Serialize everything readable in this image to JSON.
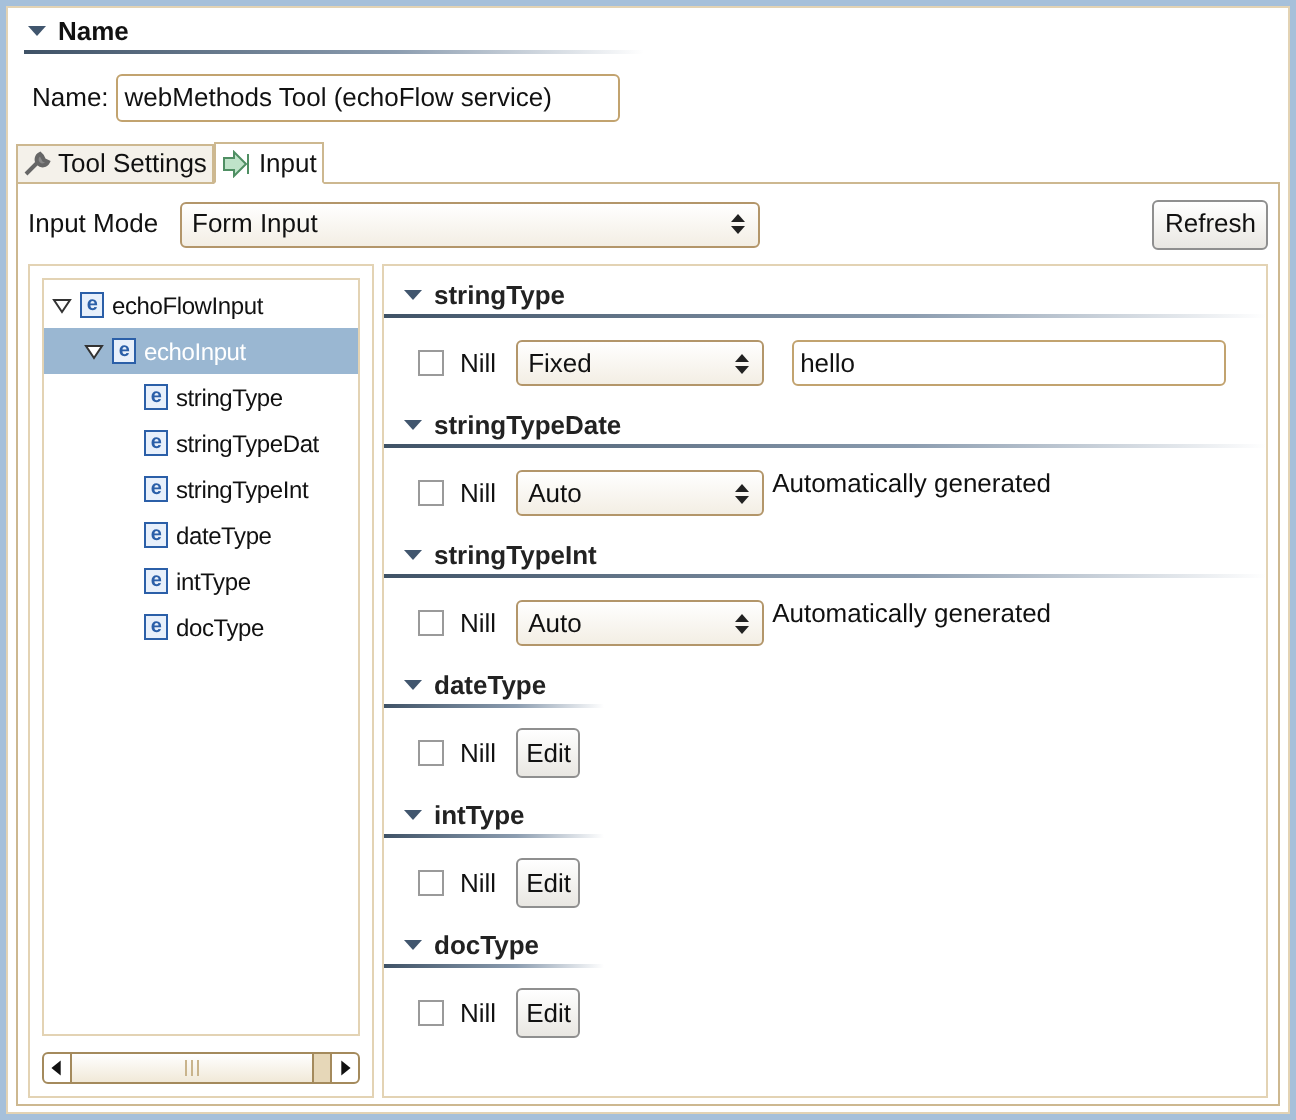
{
  "name_section": {
    "title": "Name",
    "label": "Name:",
    "value": "webMethods Tool (echoFlow service)"
  },
  "tabs": [
    {
      "label": "Tool Settings",
      "kind": "settings",
      "selected": false
    },
    {
      "label": "Input",
      "kind": "input",
      "selected": true
    }
  ],
  "input_mode": {
    "label": "Input Mode",
    "value": "Form Input",
    "refresh": "Refresh"
  },
  "tree": [
    {
      "badge": "e",
      "label": "echoFlowInput",
      "expanded": true,
      "selected": false,
      "children": [
        {
          "badge": "e",
          "label": "echoInput",
          "expanded": true,
          "selected": true,
          "children": [
            {
              "badge": "e",
              "label": "stringType",
              "selected": false
            },
            {
              "badge": "e",
              "label": "stringTypeDat",
              "selected": false
            },
            {
              "badge": "e",
              "label": "stringTypeInt",
              "selected": false
            },
            {
              "badge": "e",
              "label": "dateType",
              "selected": false
            },
            {
              "badge": "e",
              "label": "intType",
              "selected": false
            },
            {
              "badge": "e",
              "label": "docType",
              "selected": false
            }
          ]
        }
      ]
    }
  ],
  "fields": [
    {
      "title": "stringType",
      "kind": "select_text",
      "nill_label": "Nill",
      "checked": false,
      "mode": "Fixed",
      "value": "hello"
    },
    {
      "title": "stringTypeDate",
      "kind": "select_note",
      "nill_label": "Nill",
      "checked": false,
      "mode": "Auto",
      "note": "Automatically generated"
    },
    {
      "title": "stringTypeInt",
      "kind": "select_note",
      "nill_label": "Nill",
      "checked": false,
      "mode": "Auto",
      "note": "Automatically generated"
    },
    {
      "title": "dateType",
      "kind": "edit",
      "nill_label": "Nill",
      "checked": false,
      "button": "Edit"
    },
    {
      "title": "intType",
      "kind": "edit",
      "nill_label": "Nill",
      "checked": false,
      "button": "Edit"
    },
    {
      "title": "docType",
      "kind": "edit",
      "nill_label": "Nill",
      "checked": false,
      "button": "Edit"
    }
  ]
}
